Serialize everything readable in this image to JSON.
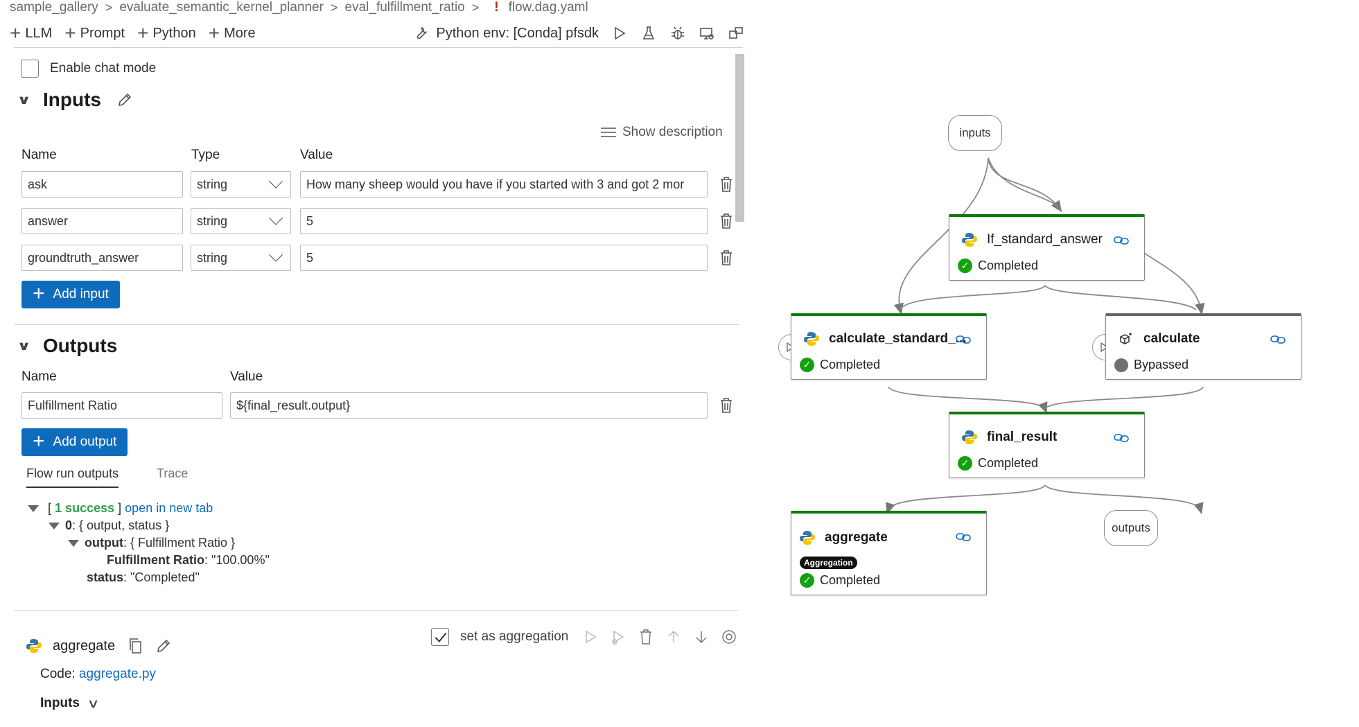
{
  "breadcrumb": {
    "items": [
      "sample_gallery",
      "evaluate_semantic_kernel_planner",
      "eval_fulfillment_ratio"
    ],
    "warning_mark": "!",
    "file": "flow.dag.yaml",
    "separator": ">"
  },
  "toolbar": {
    "add_llm": "LLM",
    "add_prompt": "Prompt",
    "add_python": "Python",
    "more": "More",
    "python_env": "Python env: [Conda] pfsdk"
  },
  "settings": {
    "enable_chat_mode": "Enable chat mode"
  },
  "inputs_section": {
    "title": "Inputs",
    "show_description": "Show description",
    "columns": {
      "name": "Name",
      "type": "Type",
      "value": "Value"
    },
    "rows": [
      {
        "name": "ask",
        "type": "string",
        "value": "How many sheep would you have if you started with 3 and got 2 mor"
      },
      {
        "name": "answer",
        "type": "string",
        "value": "5"
      },
      {
        "name": "groundtruth_answer",
        "type": "string",
        "value": "5"
      }
    ],
    "add_button": "Add input"
  },
  "outputs_section": {
    "title": "Outputs",
    "columns": {
      "name": "Name",
      "value": "Value"
    },
    "rows": [
      {
        "name": "Fulfillment Ratio",
        "value": "${final_result.output}"
      }
    ],
    "add_button": "Add output"
  },
  "run_tabs": {
    "active": "Flow run outputs",
    "inactive": "Trace"
  },
  "run_output": {
    "bracket_open": "[",
    "success": "1 success",
    "bracket_close": "]",
    "open_link": "open in new tab",
    "item_index": "0",
    "item_fields": ": { output, status }",
    "output_key": "output",
    "output_fields": ": { Fulfillment Ratio }",
    "ratio_key": "Fulfillment Ratio",
    "ratio_value": ": \"100.00%\"",
    "status_key": "status",
    "status_value": ": \"Completed\""
  },
  "node_detail": {
    "name": "aggregate",
    "set_as_aggregation": "set as aggregation",
    "code_label": "Code:",
    "code_file": "aggregate.py",
    "inputs_label": "Inputs"
  },
  "graph": {
    "inputs_node": "inputs",
    "outputs_node": "outputs",
    "nodes": {
      "if_standard_answer": {
        "title": "If_standard_answer",
        "status": "Completed"
      },
      "calculate_standard": {
        "title": "calculate_standard_...",
        "status": "Completed"
      },
      "calculate": {
        "title": "calculate",
        "status": "Bypassed"
      },
      "final_result": {
        "title": "final_result",
        "status": "Completed"
      },
      "aggregate": {
        "title": "aggregate",
        "badge": "Aggregation",
        "status": "Completed"
      }
    }
  },
  "colors": {
    "accent": "#0f6cbd",
    "completed_bar": "#0e7a0d",
    "completed_icon": "#13a10e",
    "bypassed_bar": "#666666",
    "success_text": "#2e9e4b"
  }
}
